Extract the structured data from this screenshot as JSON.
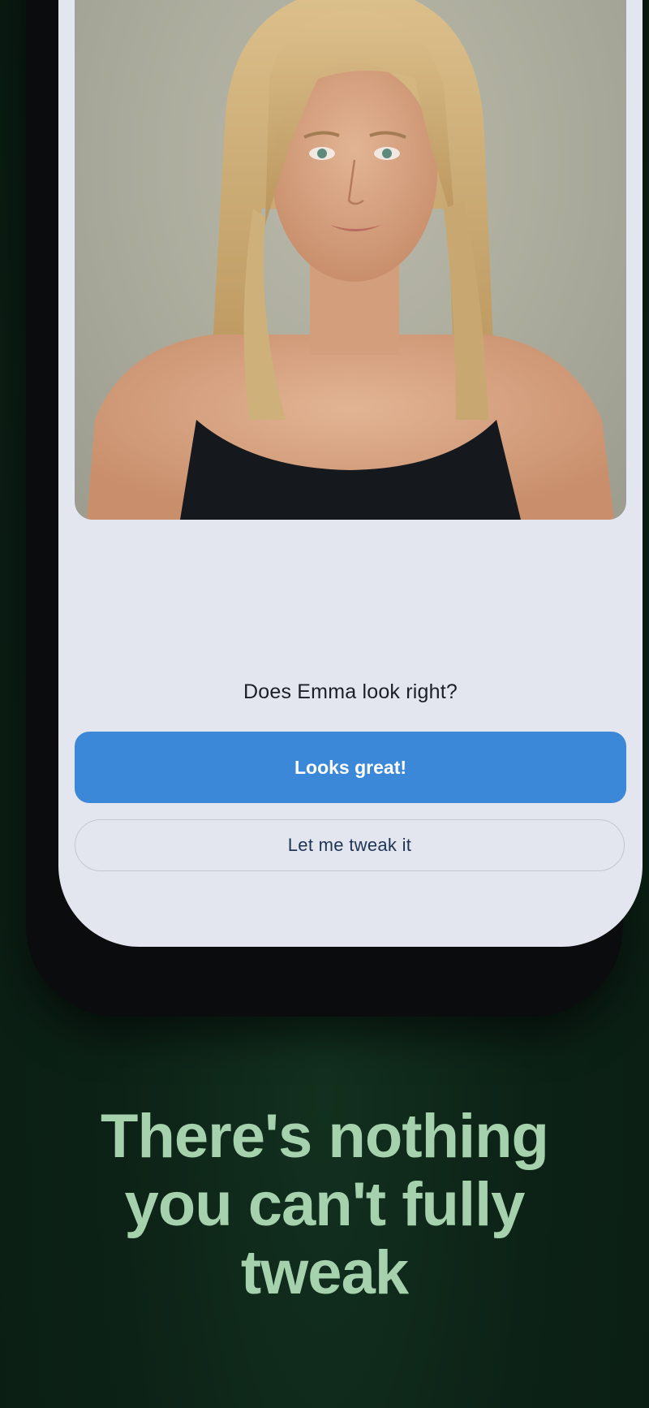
{
  "portrait": {
    "icon": "portrait-photo"
  },
  "prompt": {
    "question": "Does Emma look right?"
  },
  "actions": {
    "primary_label": "Looks great!",
    "secondary_label": "Let me tweak it"
  },
  "headline": {
    "line1": "There's nothing",
    "line2": "you can't fully",
    "line3": "tweak"
  },
  "colors": {
    "primary_button": "#3b87d8",
    "screen_background": "#e3e6ef",
    "page_background": "#0c2216",
    "headline_text": "#a6d1ad"
  }
}
